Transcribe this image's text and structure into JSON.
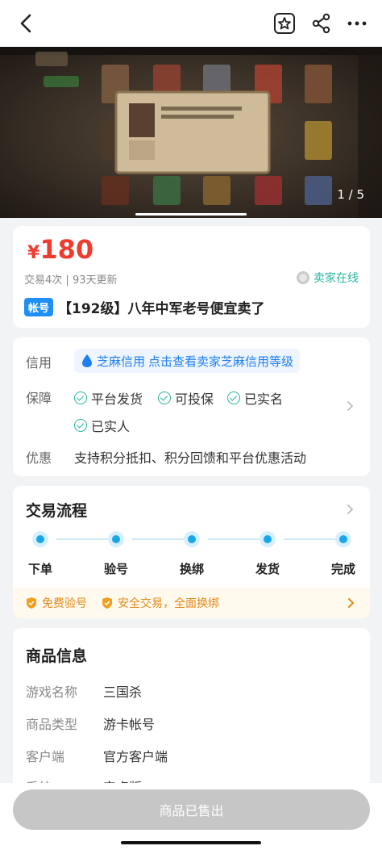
{
  "gallery": {
    "counter": "1 / 5",
    "current": 1,
    "total": 5
  },
  "listing": {
    "currency": "¥",
    "price": "180",
    "trades": "交易4次",
    "separator": "|",
    "updated": "93天更新",
    "seller_status": "卖家在线",
    "tag": "帐号",
    "title": "【192级】八年中军老号便宜卖了"
  },
  "guarantee": {
    "credit_label": "信用",
    "credit_badge": "芝麻信用",
    "credit_link": "点击查看卖家芝麻信用等级",
    "guarantee_label": "保障",
    "items": [
      "平台发货",
      "可投保",
      "已实名",
      "已实人"
    ],
    "promo_label": "优惠",
    "promo_text": "支持积分抵扣、积分回馈和平台优惠活动"
  },
  "process": {
    "title": "交易流程",
    "steps": [
      "下单",
      "验号",
      "换绑",
      "发货",
      "完成"
    ],
    "safe_1": "免费验号",
    "safe_2": "安全交易，全面换绑"
  },
  "product": {
    "title": "商品信息",
    "rows": [
      {
        "k": "游戏名称",
        "v": "三国杀"
      },
      {
        "k": "商品类型",
        "v": "游卡帐号"
      },
      {
        "k": "客户端",
        "v": "官方客户端"
      },
      {
        "k": "系统",
        "v": "安卓版"
      }
    ]
  },
  "footer": {
    "sold_label": "商品已售出"
  },
  "colors": {
    "price": "#f23b2f",
    "accent_blue": "#1f8ef5",
    "teal": "#2bb5a0",
    "orange": "#e38a1a"
  }
}
